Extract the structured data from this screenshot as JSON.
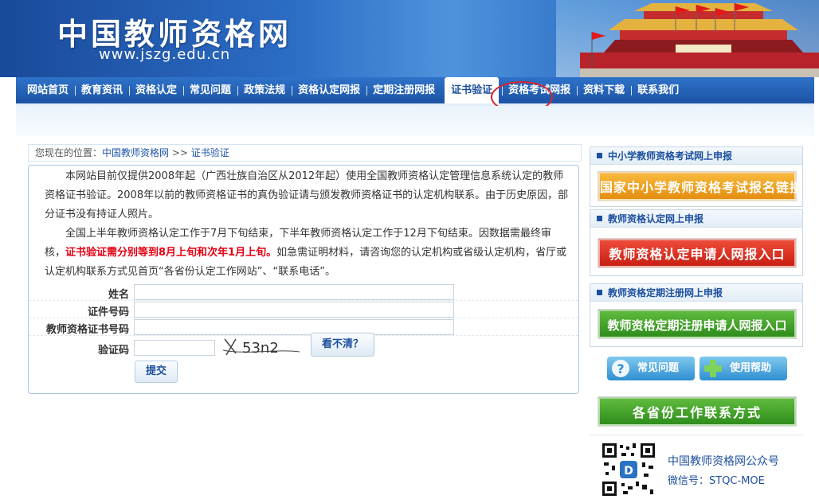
{
  "header": {
    "logo_text": "中国教师资格网",
    "logo_url": "www.jszg.edu.cn"
  },
  "nav": {
    "items": [
      {
        "label": "网站首页"
      },
      {
        "label": "教育资讯"
      },
      {
        "label": "资格认定"
      },
      {
        "label": "常见问题"
      },
      {
        "label": "政策法规"
      },
      {
        "label": "资格认定网报"
      },
      {
        "label": "定期注册网报"
      },
      {
        "label": "证书验证"
      },
      {
        "label": "资格考试网报"
      },
      {
        "label": "资料下载"
      },
      {
        "label": "联系我们"
      }
    ],
    "active_index": 7
  },
  "breadcrumb": {
    "prefix": "您现在的位置：",
    "home": "中国教师资格网",
    "sep": " >> ",
    "current": "证书验证"
  },
  "notice": {
    "p1": "本网站目前仅提供2008年起（广西壮族自治区从2012年起）使用全国教师资格认定管理信息系统认定的教师资格证书验证。2008年以前的教师资格证书的真伪验证请与颁发教师资格证书的认定机构联系。由于历史原因，部分证书没有持证人照片。",
    "p2_a": "全国上半年教师资格认定工作于7月下旬结束，下半年教师资格认定工作于12月下旬结束。因数据需最终审核，",
    "p2_red": "证书验证需分别等到8月上旬和次年1月上旬。",
    "p2_b": "如急需证明材料，请咨询您的认定机构或省级认定机构，省厅或认定机构联系方式见首页“各省份认定工作网站”、“联系电话”。"
  },
  "form": {
    "name_label": "姓名",
    "id_label": "证件号码",
    "cert_label": "教师资格证书号码",
    "captcha_label": "验证码",
    "captcha_text": "53n2",
    "refresh_label": "看不清？",
    "submit_label": "提交"
  },
  "sidebar": {
    "panel1_title": "中小学教师资格考试网上申报",
    "panel1_button": "国家中小学教师资格考试报名链接",
    "panel2_title": "教师资格认定网上申报",
    "panel2_button": "教师资格认定申请人网报入口",
    "panel3_title": "教师资格定期注册网上申报",
    "panel3_button": "教师资格定期注册申请人网报入口",
    "faq_label": "常见问题",
    "help_label": "使用帮助",
    "contact_label": "各省份工作联系方式",
    "wechat_title": "中国教师资格网公众号",
    "wechat_id": "微信号：STQC-MOE"
  },
  "colors": {
    "nav_blue": "#1c53a4",
    "accent_red": "#e60012",
    "link_blue": "#1f56a8"
  }
}
